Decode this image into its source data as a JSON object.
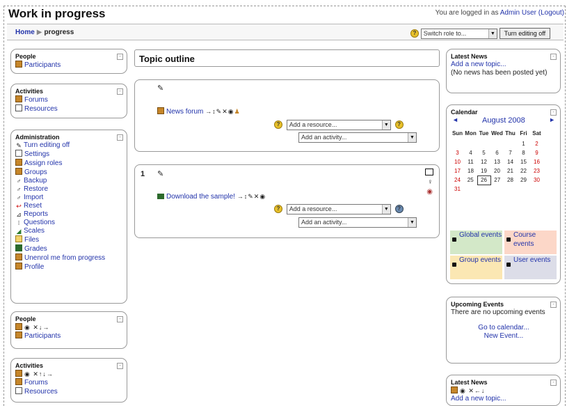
{
  "header": {
    "title": "Work in progress",
    "login_prefix": "You are logged in as",
    "login_user": "Admin User",
    "logout": "(Logout)"
  },
  "navbar": {
    "home": "Home",
    "current": "progress",
    "switch_role": "Switch role to...",
    "turn_editing": "Turn editing off"
  },
  "left": {
    "people": {
      "title": "People",
      "items": [
        "Participants"
      ]
    },
    "activities": {
      "title": "Activities",
      "items": [
        "Forums",
        "Resources"
      ]
    },
    "admin": {
      "title": "Administration",
      "items": [
        "Turn editing off",
        "Settings",
        "Assign roles",
        "Groups",
        "Backup",
        "Restore",
        "Import",
        "Reset",
        "Reports",
        "Questions",
        "Scales",
        "Files",
        "Grades",
        "Unenrol me from progress",
        "Profile"
      ]
    },
    "people2": {
      "title": "People",
      "controls": "→",
      "items": [
        "Participants"
      ]
    },
    "activities2": {
      "title": "Activities",
      "items": [
        "Forums",
        "Resources"
      ]
    }
  },
  "center": {
    "topic_outline": "Topic outline",
    "section0": {
      "forum": "News forum",
      "add_resource": "Add a resource...",
      "add_activity": "Add an activity..."
    },
    "section1": {
      "number": "1",
      "download": "Download the sample!",
      "add_resource": "Add a resource...",
      "add_activity": "Add an activity..."
    }
  },
  "right": {
    "latest_news": {
      "title": "Latest News",
      "add": "Add a new topic...",
      "none": "(No news has been posted yet)"
    },
    "calendar": {
      "title": "Calendar",
      "month": "August 2008",
      "days": [
        "Sun",
        "Mon",
        "Tue",
        "Wed",
        "Thu",
        "Fri",
        "Sat"
      ],
      "weeks": [
        [
          "",
          "",
          "",
          "",
          "",
          "1",
          "2"
        ],
        [
          "3",
          "4",
          "5",
          "6",
          "7",
          "8",
          "9"
        ],
        [
          "10",
          "11",
          "12",
          "13",
          "14",
          "15",
          "16"
        ],
        [
          "17",
          "18",
          "19",
          "20",
          "21",
          "22",
          "23"
        ],
        [
          "24",
          "25",
          "26",
          "27",
          "28",
          "29",
          "30"
        ],
        [
          "31",
          "",
          "",
          "",
          "",
          "",
          ""
        ]
      ],
      "legend": {
        "global": "Global events",
        "course": "Course events",
        "group": "Group events",
        "user": "User events"
      },
      "colors": {
        "global": "#d3e8c8",
        "course": "#fcd7c8",
        "group": "#fbe7b3",
        "user": "#dcdde8"
      }
    },
    "upcoming": {
      "title": "Upcoming Events",
      "none": "There are no upcoming events",
      "goto": "Go to calendar...",
      "new_event": "New Event..."
    },
    "latest_news2": {
      "title": "Latest News",
      "add": "Add a new topic..."
    }
  }
}
